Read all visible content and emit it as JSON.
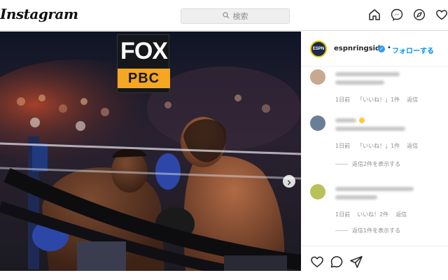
{
  "app": {
    "logo_text": "Instagram",
    "search_placeholder": "検索"
  },
  "nav_icons": [
    "home-icon",
    "messenger-icon",
    "explore-icon",
    "heart-icon"
  ],
  "media": {
    "broadcast_badge_top": "FOX",
    "broadcast_badge_bottom": "PBC",
    "next_icon": "chevron-right-icon"
  },
  "post": {
    "account": "espnringside",
    "avatar_text": "ESPN",
    "verified": true,
    "separator": "•",
    "follow_label": "フォローする"
  },
  "comments": [
    {
      "time": "1日前",
      "likes": "「いいね！」1件",
      "reply_label": "返信",
      "view_replies": ""
    },
    {
      "time": "1日前",
      "likes": "「いいね！」1件",
      "reply_label": "返信",
      "view_replies": "返信2件を表示する"
    },
    {
      "time": "1日前",
      "likes": "いいね！2件",
      "reply_label": "返信",
      "view_replies": "返信1件を表示する"
    }
  ],
  "action_icons": [
    "heart-outline-icon",
    "comment-icon",
    "share-icon"
  ],
  "colors": {
    "link_blue": "#0095f6",
    "verified_blue": "#3897f0",
    "badge_orange": "#f5a623",
    "muted_text": "#8e8e8e"
  }
}
